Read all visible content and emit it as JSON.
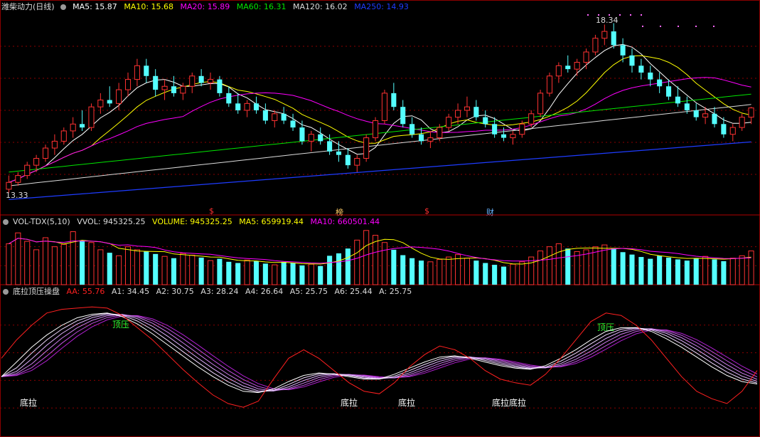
{
  "colors": {
    "up": "#ff3232",
    "down": "#54ffff",
    "ma5": "#ffffff",
    "ma10": "#ffff00",
    "ma20": "#ff00ff",
    "ma60": "#00e600",
    "ma120": "#dcdcdc",
    "ma250": "#1e3cff",
    "grid": "#8b0000",
    "aa": "#ff2020",
    "vol_ma10": "#ff00ff",
    "green_label": "#33ff33"
  },
  "main": {
    "title": "潍柴动力(日线)",
    "ma": [
      {
        "label": "MA5: 15.87",
        "color": "#ffffff"
      },
      {
        "label": "MA10: 15.68",
        "color": "#ffff00"
      },
      {
        "label": "MA20: 15.89",
        "color": "#ff00ff"
      },
      {
        "label": "MA60: 16.31",
        "color": "#00e600"
      },
      {
        "label": "MA120: 16.02",
        "color": "#dcdcdc"
      },
      {
        "label": "MA250: 14.93",
        "color": "#1e3cff"
      }
    ],
    "high_label": "18.34",
    "low_label": "13.33",
    "markers": [
      {
        "text": "$",
        "color": "#ff3030"
      },
      {
        "text": "榜",
        "color": "#ffcc66"
      },
      {
        "text": "$",
        "color": "#ff3030"
      },
      {
        "text": "财",
        "color": "#66b3ff"
      }
    ]
  },
  "volume": {
    "title": "VOL-TDX(5,10)",
    "items": [
      {
        "label": "VVOL: 945325.25",
        "color": "#dcdcdc"
      },
      {
        "label": "VOLUME: 945325.25",
        "color": "#ffff00"
      },
      {
        "label": "MA5: 659919.44",
        "color": "#ffff00"
      },
      {
        "label": "MA10: 660501.44",
        "color": "#ff00ff"
      }
    ]
  },
  "indicator": {
    "title": "底拉顶压操盘",
    "items": [
      {
        "label": "AA: 55.76",
        "color": "#ff2020"
      },
      {
        "label": "A1: 34.45",
        "color": "#dcdcdc"
      },
      {
        "label": "A2: 30.75",
        "color": "#dcdcdc"
      },
      {
        "label": "A3: 28.24",
        "color": "#dcdcdc"
      },
      {
        "label": "A4: 26.64",
        "color": "#dcdcdc"
      },
      {
        "label": "A5: 25.75",
        "color": "#dcdcdc"
      },
      {
        "label": "A6: 25.44",
        "color": "#dcdcdc"
      },
      {
        "label": "A: 25.75",
        "color": "#dcdcdc"
      }
    ],
    "top_label": "顶压",
    "bottom_label": "底拉",
    "bottom_double_label": "底拉底拉"
  },
  "chart_data": [
    {
      "type": "candlestick",
      "title": "潍柴动力(日线)",
      "price_range": [
        13.0,
        18.6
      ],
      "grid": true,
      "ohlc": [
        [
          13.5,
          13.9,
          13.4,
          13.7
        ],
        [
          13.7,
          14.0,
          13.6,
          13.9
        ],
        [
          13.9,
          14.3,
          13.8,
          14.2
        ],
        [
          14.2,
          14.5,
          14.0,
          14.4
        ],
        [
          14.4,
          14.8,
          14.3,
          14.7
        ],
        [
          14.7,
          15.1,
          14.5,
          14.9
        ],
        [
          14.9,
          15.3,
          14.8,
          15.2
        ],
        [
          15.2,
          15.6,
          15.0,
          15.4
        ],
        [
          15.4,
          15.8,
          15.2,
          15.3
        ],
        [
          15.3,
          16.0,
          15.2,
          15.9
        ],
        [
          15.9,
          16.3,
          15.7,
          16.1
        ],
        [
          16.1,
          16.5,
          15.9,
          16.0
        ],
        [
          16.0,
          16.6,
          15.8,
          16.4
        ],
        [
          16.4,
          16.9,
          16.2,
          16.7
        ],
        [
          16.7,
          17.3,
          16.5,
          17.1
        ],
        [
          17.1,
          17.3,
          16.6,
          16.8
        ],
        [
          16.8,
          17.0,
          16.2,
          16.4
        ],
        [
          16.4,
          16.7,
          16.1,
          16.5
        ],
        [
          16.5,
          16.8,
          16.2,
          16.3
        ],
        [
          16.3,
          16.6,
          16.1,
          16.5
        ],
        [
          16.5,
          16.9,
          16.3,
          16.8
        ],
        [
          16.8,
          17.0,
          16.5,
          16.6
        ],
        [
          16.6,
          16.9,
          16.4,
          16.7
        ],
        [
          16.7,
          16.8,
          16.2,
          16.3
        ],
        [
          16.3,
          16.5,
          15.9,
          16.0
        ],
        [
          16.0,
          16.3,
          15.7,
          15.8
        ],
        [
          15.8,
          16.1,
          15.6,
          16.0
        ],
        [
          16.0,
          16.2,
          15.7,
          15.8
        ],
        [
          15.8,
          16.0,
          15.4,
          15.5
        ],
        [
          15.5,
          15.8,
          15.3,
          15.7
        ],
        [
          15.7,
          15.9,
          15.4,
          15.5
        ],
        [
          15.5,
          15.7,
          15.2,
          15.3
        ],
        [
          15.3,
          15.5,
          14.8,
          14.9
        ],
        [
          14.9,
          15.2,
          14.6,
          15.1
        ],
        [
          15.1,
          15.3,
          14.8,
          14.9
        ],
        [
          14.9,
          15.1,
          14.5,
          14.6
        ],
        [
          14.6,
          14.9,
          14.3,
          14.5
        ],
        [
          14.5,
          14.7,
          14.1,
          14.2
        ],
        [
          14.2,
          14.5,
          14.0,
          14.4
        ],
        [
          14.4,
          15.1,
          14.3,
          15.0
        ],
        [
          15.0,
          15.6,
          14.9,
          15.5
        ],
        [
          15.5,
          16.4,
          15.4,
          16.3
        ],
        [
          16.3,
          16.6,
          15.8,
          15.9
        ],
        [
          15.9,
          16.1,
          15.3,
          15.4
        ],
        [
          15.4,
          15.6,
          15.0,
          15.1
        ],
        [
          15.1,
          15.3,
          14.8,
          14.9
        ],
        [
          14.9,
          15.2,
          14.7,
          15.0
        ],
        [
          15.0,
          15.4,
          14.9,
          15.3
        ],
        [
          15.3,
          15.7,
          15.2,
          15.6
        ],
        [
          15.6,
          16.0,
          15.4,
          15.8
        ],
        [
          15.8,
          16.2,
          15.6,
          15.9
        ],
        [
          15.9,
          16.1,
          15.5,
          15.6
        ],
        [
          15.6,
          15.8,
          15.3,
          15.4
        ],
        [
          15.4,
          15.6,
          15.0,
          15.1
        ],
        [
          15.1,
          15.3,
          14.9,
          15.0
        ],
        [
          15.0,
          15.2,
          14.8,
          15.1
        ],
        [
          15.1,
          15.5,
          15.0,
          15.4
        ],
        [
          15.4,
          15.8,
          15.3,
          15.7
        ],
        [
          15.7,
          16.4,
          15.6,
          16.3
        ],
        [
          16.3,
          16.9,
          16.2,
          16.8
        ],
        [
          16.8,
          17.2,
          16.6,
          17.1
        ],
        [
          17.1,
          17.4,
          16.9,
          17.0
        ],
        [
          17.0,
          17.3,
          16.8,
          17.2
        ],
        [
          17.2,
          17.6,
          17.0,
          17.5
        ],
        [
          17.5,
          18.0,
          17.4,
          17.9
        ],
        [
          17.9,
          18.3,
          17.7,
          18.1
        ],
        [
          18.1,
          18.34,
          17.6,
          17.7
        ],
        [
          17.7,
          17.9,
          17.2,
          17.4
        ],
        [
          17.4,
          17.6,
          16.9,
          17.1
        ],
        [
          17.1,
          17.3,
          16.7,
          16.9
        ],
        [
          16.9,
          17.1,
          16.5,
          16.7
        ],
        [
          16.7,
          16.9,
          16.3,
          16.5
        ],
        [
          16.5,
          16.7,
          16.1,
          16.2
        ],
        [
          16.2,
          16.5,
          15.9,
          16.0
        ],
        [
          16.0,
          16.2,
          15.7,
          15.8
        ],
        [
          15.8,
          16.0,
          15.5,
          15.6
        ],
        [
          15.6,
          15.9,
          15.4,
          15.7
        ],
        [
          15.7,
          15.9,
          15.3,
          15.4
        ],
        [
          15.4,
          15.6,
          15.0,
          15.1
        ],
        [
          15.1,
          15.4,
          14.9,
          15.3
        ],
        [
          15.3,
          15.7,
          15.2,
          15.6
        ],
        [
          15.6,
          15.9,
          15.4,
          15.87
        ]
      ],
      "volume": [
        68,
        86,
        72,
        58,
        78,
        63,
        67,
        88,
        73,
        70,
        58,
        53,
        48,
        63,
        58,
        55,
        51,
        47,
        44,
        52,
        49,
        45,
        40,
        43,
        38,
        36,
        41,
        39,
        35,
        33,
        38,
        36,
        32,
        34,
        31,
        48,
        52,
        60,
        74,
        90,
        82,
        70,
        58,
        49,
        44,
        40,
        38,
        42,
        46,
        50,
        44,
        40,
        36,
        33,
        30,
        34,
        38,
        46,
        56,
        63,
        68,
        60,
        55,
        58,
        63,
        66,
        60,
        54,
        50,
        46,
        43,
        48,
        45,
        42,
        40,
        44,
        47,
        42,
        39,
        44,
        48,
        56
      ]
    },
    {
      "type": "line",
      "title": "底拉顶压操盘",
      "series": [
        {
          "name": "AA",
          "values": [
            55,
            70,
            82,
            92,
            95,
            96,
            97,
            96,
            90,
            80,
            70,
            58,
            46,
            35,
            25,
            18,
            15,
            20,
            38,
            55,
            62,
            55,
            45,
            35,
            28,
            26,
            35,
            48,
            58,
            65,
            62,
            55,
            45,
            38,
            35,
            33,
            42,
            55,
            70,
            85,
            92,
            90,
            82,
            70,
            55,
            40,
            28,
            22,
            18,
            28,
            45
          ]
        },
        {
          "name": "A1",
          "values": [
            40,
            52,
            64,
            74,
            82,
            88,
            91,
            92,
            89,
            83,
            75,
            66,
            57,
            48,
            40,
            33,
            28,
            27,
            30,
            36,
            41,
            43,
            42,
            40,
            38,
            38,
            42,
            47,
            52,
            56,
            57,
            55,
            52,
            49,
            47,
            46,
            49,
            55,
            62,
            70,
            77,
            80,
            80,
            77,
            71,
            64,
            56,
            48,
            41,
            36,
            34
          ]
        }
      ]
    }
  ]
}
